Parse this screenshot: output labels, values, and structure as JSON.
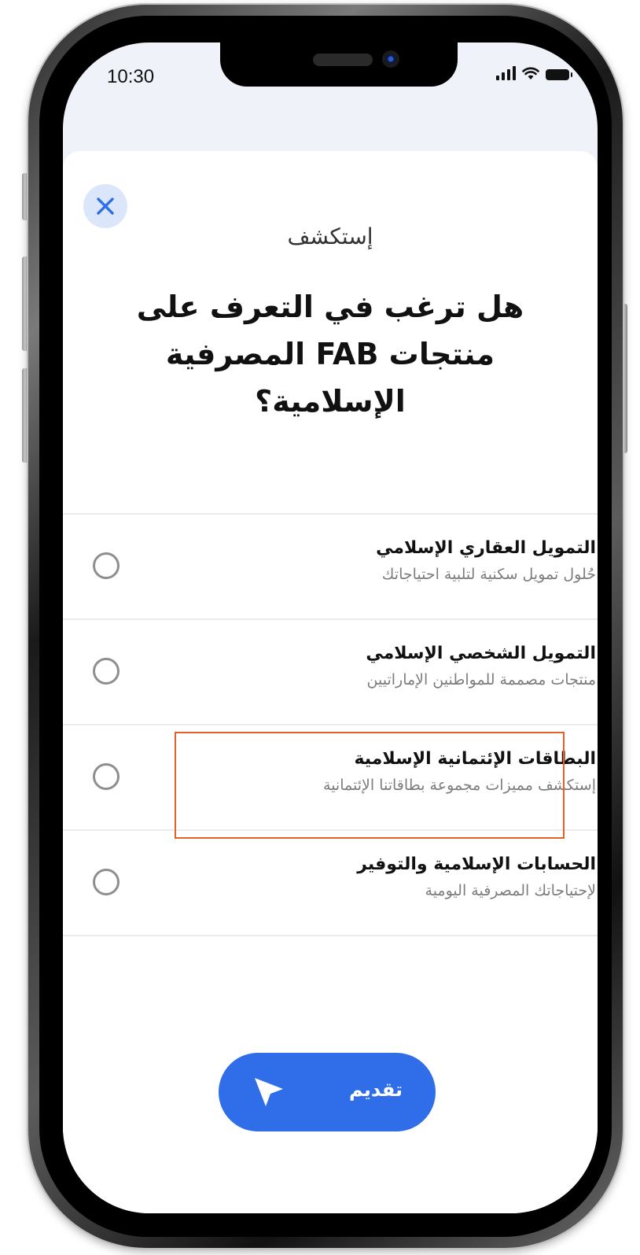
{
  "status_bar": {
    "time": "10:30"
  },
  "sheet": {
    "close_icon": "close-icon",
    "kicker": "إستكشف",
    "question": "هل ترغب في التعرف على منتجات FAB المصرفية الإسلامية؟"
  },
  "options": [
    {
      "title": "التمويل العقاري الإسلامي",
      "subtitle": "حُلول تمويل سكنية لتلبية احتياجاتك",
      "selected": false
    },
    {
      "title": "التمويل الشخصي الإسلامي",
      "subtitle": "منتجات مصممة للمواطنين الإماراتيين",
      "selected": false
    },
    {
      "title": "البطاقات الإئتمانية الإسلامية",
      "subtitle": "إستكشف مميزات مجموعة بطاقاتنا الإئتمانية",
      "selected": false
    },
    {
      "title": "الحسابات الإسلامية والتوفير",
      "subtitle": "لإحتياجاتك المصرفية اليومية",
      "selected": false
    }
  ],
  "submit_button": {
    "label": "تقديم",
    "icon": "send-icon"
  },
  "colors": {
    "accent": "#2f6ee8",
    "close_bg": "#dce6fb",
    "highlight": "#e2622a"
  }
}
